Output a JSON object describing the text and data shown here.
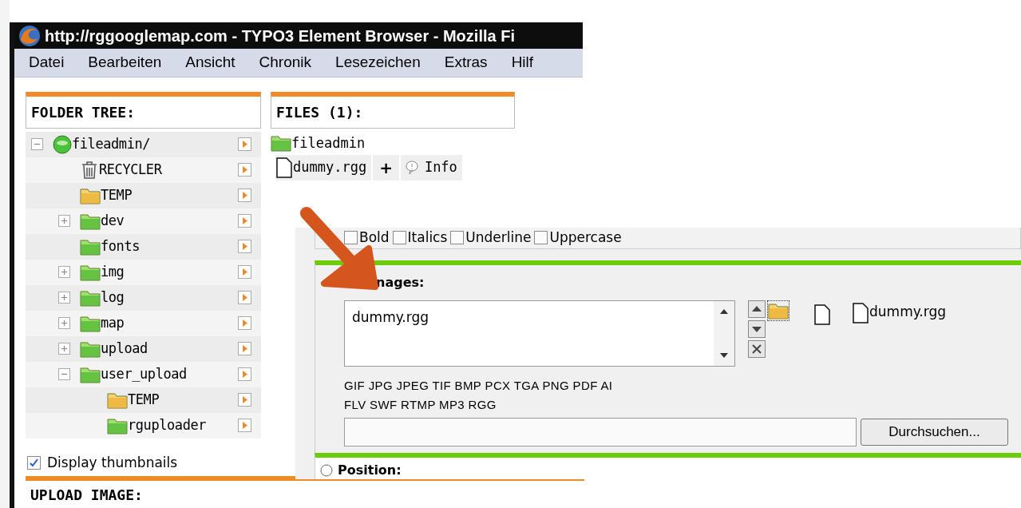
{
  "window": {
    "title": "http://rggooglemap.com - TYPO3 Element Browser - Mozilla Fi"
  },
  "menu": [
    {
      "label": "Datei"
    },
    {
      "label": "Bearbeiten"
    },
    {
      "label": "Ansicht"
    },
    {
      "label": "Chronik"
    },
    {
      "label": "Lesezeichen"
    },
    {
      "label": "Extras"
    },
    {
      "label": "Hilf"
    }
  ],
  "folder_tree": {
    "heading": "FOLDER TREE:",
    "items": [
      {
        "label": "fileadmin/",
        "kind": "globe",
        "expanded": true,
        "children": [
          {
            "label": "RECYCLER",
            "kind": "recycler"
          },
          {
            "label": "TEMP",
            "kind": "temp_folder"
          },
          {
            "label": "dev",
            "kind": "folder",
            "expanded": false
          },
          {
            "label": "fonts",
            "kind": "folder"
          },
          {
            "label": "img",
            "kind": "folder",
            "expanded": false
          },
          {
            "label": "log",
            "kind": "folder",
            "expanded": false
          },
          {
            "label": "map",
            "kind": "folder",
            "expanded": false
          },
          {
            "label": "upload",
            "kind": "folder",
            "expanded": false
          },
          {
            "label": "user_upload",
            "kind": "folder",
            "expanded": true,
            "children": [
              {
                "label": "TEMP",
                "kind": "temp_folder"
              },
              {
                "label": "rguploader",
                "kind": "folder"
              }
            ]
          }
        ]
      }
    ]
  },
  "display_thumbnails": {
    "label": "Display thumbnails",
    "checked": true
  },
  "upload": {
    "heading": "UPLOAD IMAGE:"
  },
  "files": {
    "heading": "FILES (1):",
    "folder": "fileadmin",
    "file": {
      "name": "dummy.rgg",
      "add": "+",
      "info": "Info"
    }
  },
  "form": {
    "styles": [
      {
        "label": "Bold",
        "checked": false
      },
      {
        "label": "Italics",
        "checked": false
      },
      {
        "label": "Underline",
        "checked": false
      },
      {
        "label": "Uppercase",
        "checked": false
      }
    ],
    "images": {
      "label": "nages:",
      "value": "dummy.rgg",
      "preview": "dummy.rgg",
      "types": [
        "GIF JPG JPEG TIF BMP PCX TGA PNG PDF AI",
        "FLV SWF RTMP MP3 RGG"
      ],
      "browse": "Durchsuchen..."
    },
    "position": {
      "label": "Position:"
    }
  }
}
